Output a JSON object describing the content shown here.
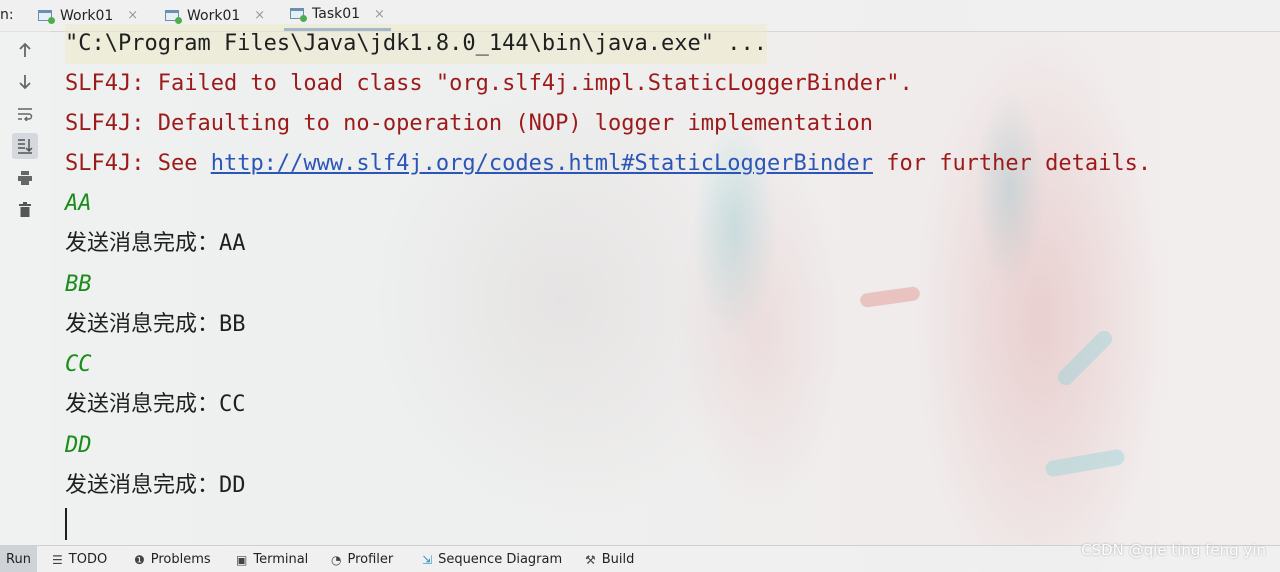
{
  "tabs": {
    "prefix": "n:",
    "items": [
      {
        "label": "Work01",
        "close": "×"
      },
      {
        "label": "Work01",
        "close": "×"
      },
      {
        "label": "Task01",
        "close": "×"
      }
    ]
  },
  "gutter": {
    "icons": [
      "arrow-up-icon",
      "arrow-down-icon",
      "soft-wrap-icon",
      "scroll-to-end-icon",
      "print-icon",
      "trash-icon"
    ]
  },
  "console": {
    "command": "\"C:\\Program Files\\Java\\jdk1.8.0_144\\bin\\java.exe\" ...",
    "slf4j_1": "SLF4J: Failed to load class \"org.slf4j.impl.StaticLoggerBinder\".",
    "slf4j_2": "SLF4J: Defaulting to no-operation (NOP) logger implementation",
    "slf4j_3_prefix": "SLF4J: See ",
    "slf4j_3_link": "http://www.slf4j.org/codes.html#StaticLoggerBinder",
    "slf4j_3_suffix": " for further details.",
    "outputs": [
      {
        "value": "AA",
        "message": "发送消息完成：AA"
      },
      {
        "value": "BB",
        "message": "发送消息完成：BB"
      },
      {
        "value": "CC",
        "message": "发送消息完成：CC"
      },
      {
        "value": "DD",
        "message": "发送消息完成：DD"
      }
    ]
  },
  "bottombar": {
    "items": [
      {
        "label": "Run",
        "icon": ""
      },
      {
        "label": "TODO",
        "icon": "list-icon"
      },
      {
        "label": "Problems",
        "icon": "problems-icon"
      },
      {
        "label": "Terminal",
        "icon": "terminal-icon"
      },
      {
        "label": "Profiler",
        "icon": "profiler-icon"
      },
      {
        "label": "Sequence Diagram",
        "icon": "sequence-diagram-icon"
      },
      {
        "label": "Build",
        "icon": "hammer-icon"
      }
    ]
  },
  "watermark": "CSDN @qie ting feng yin",
  "colors": {
    "error_text": "#9c1a1a",
    "link": "#2b56b8",
    "output_green": "#1a8c1a",
    "active_tab_underline": "#4a7cc7"
  }
}
